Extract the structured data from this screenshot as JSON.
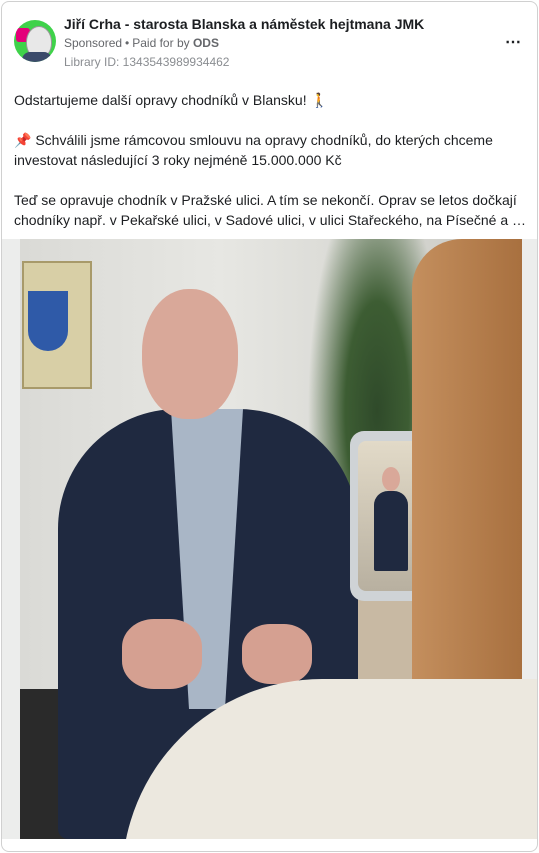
{
  "ad": {
    "page_name": "Jiří Crha - starosta Blanska a náměstek hejtmana JMK",
    "sponsored_label": "Sponsored",
    "dot": "•",
    "paid_for_label": "Paid for by",
    "paid_for_party": "ODS",
    "library_id": "Library ID: 1343543989934462",
    "more_icon": "⋯"
  },
  "post": {
    "line1": "Odstartujeme další opravy chodníků v Blansku! 🚶",
    "line2": "📌 Schválili jsme rámcovou smlouvu na opravy chodníků, do kterých chceme investovat následující 3 roky nejméně 15.000.000 Kč",
    "line3a": "Teď se opravuje chodník v Pražské ulici. A tím se nekončí. Oprav se letos dočkají",
    "line3b": "chodníky např. v Pekařské ulici, v Sadové ulici, v ulici Stařeckého, na Písečné a na…"
  }
}
